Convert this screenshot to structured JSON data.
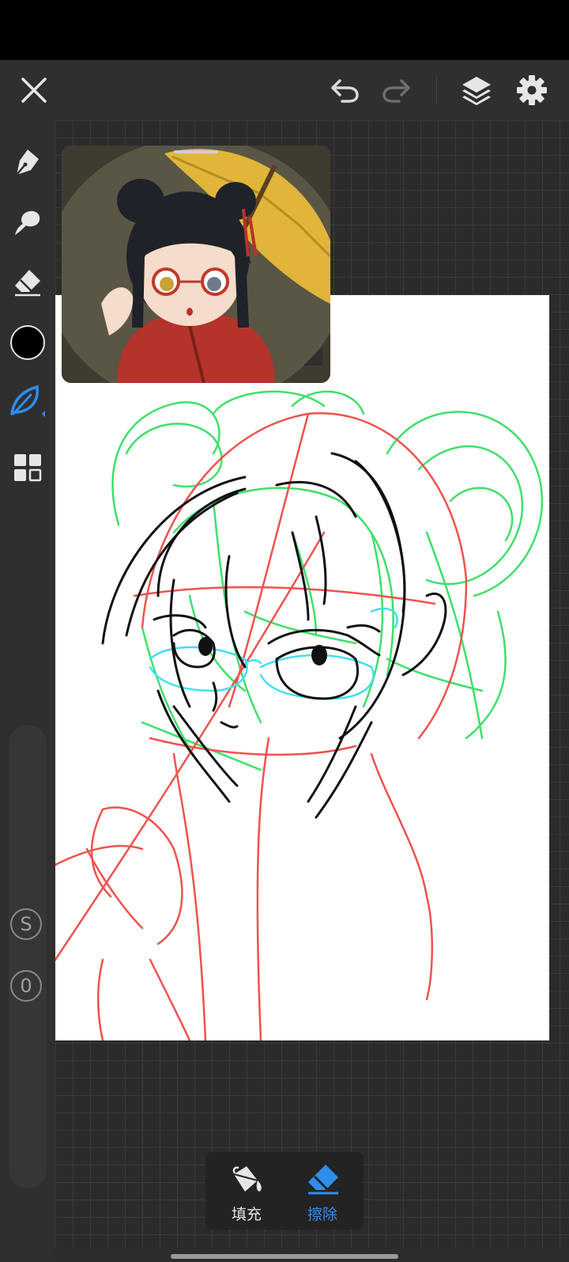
{
  "toolbar": {
    "close": "close-icon",
    "undo": "undo-icon",
    "redo": "redo-icon",
    "layers": "layers-icon",
    "settings": "gear-icon"
  },
  "sidebar": {
    "tools": [
      "pen-icon",
      "smudge-icon",
      "eraser-icon",
      "color-swatch",
      "leaf-brush-icon",
      "grid-icon"
    ],
    "current_color": "#000000",
    "active_tool": "leaf-brush",
    "size_label": "S",
    "opacity_label": "0"
  },
  "bottom_panel": {
    "fill_label": "填充",
    "erase_label": "擦除",
    "active": "erase"
  },
  "colors": {
    "accent": "#2f8df0",
    "sketch_red": "#f0524e",
    "sketch_green": "#3ee06a",
    "sketch_cyan": "#40e0f0",
    "ink": "#111111"
  }
}
